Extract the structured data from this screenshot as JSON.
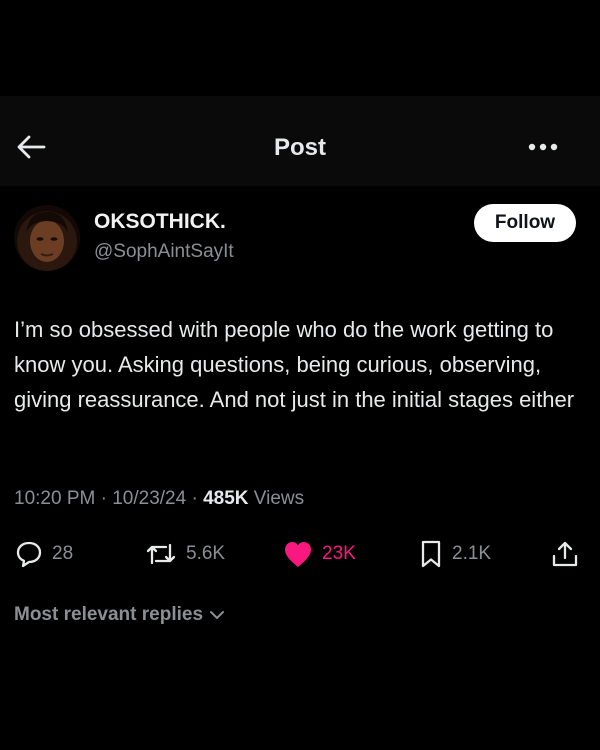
{
  "header": {
    "title": "Post",
    "back_icon": "arrow-left-icon",
    "more_icon": "more-horizontal-icon"
  },
  "author": {
    "display_name": "OKSOTHICK.",
    "handle": "@SophAintSayIt",
    "follow_label": "Follow"
  },
  "post": {
    "text": "I’m so obsessed with people who do the work getting to know you. Asking questions, being curious, observing, giving reassurance. And not just in the initial stages either",
    "time": "10:20 PM",
    "date": "10/23/24",
    "views_count": "485K",
    "views_label": "Views"
  },
  "actions": {
    "replies": "28",
    "reposts": "5.6K",
    "likes": "23K",
    "bookmarks": "2.1K"
  },
  "replies_sort": {
    "label": "Most relevant replies"
  },
  "colors": {
    "background": "#000000",
    "text": "#e7e9ea",
    "muted": "#8b8f94",
    "like": "#f91880"
  }
}
